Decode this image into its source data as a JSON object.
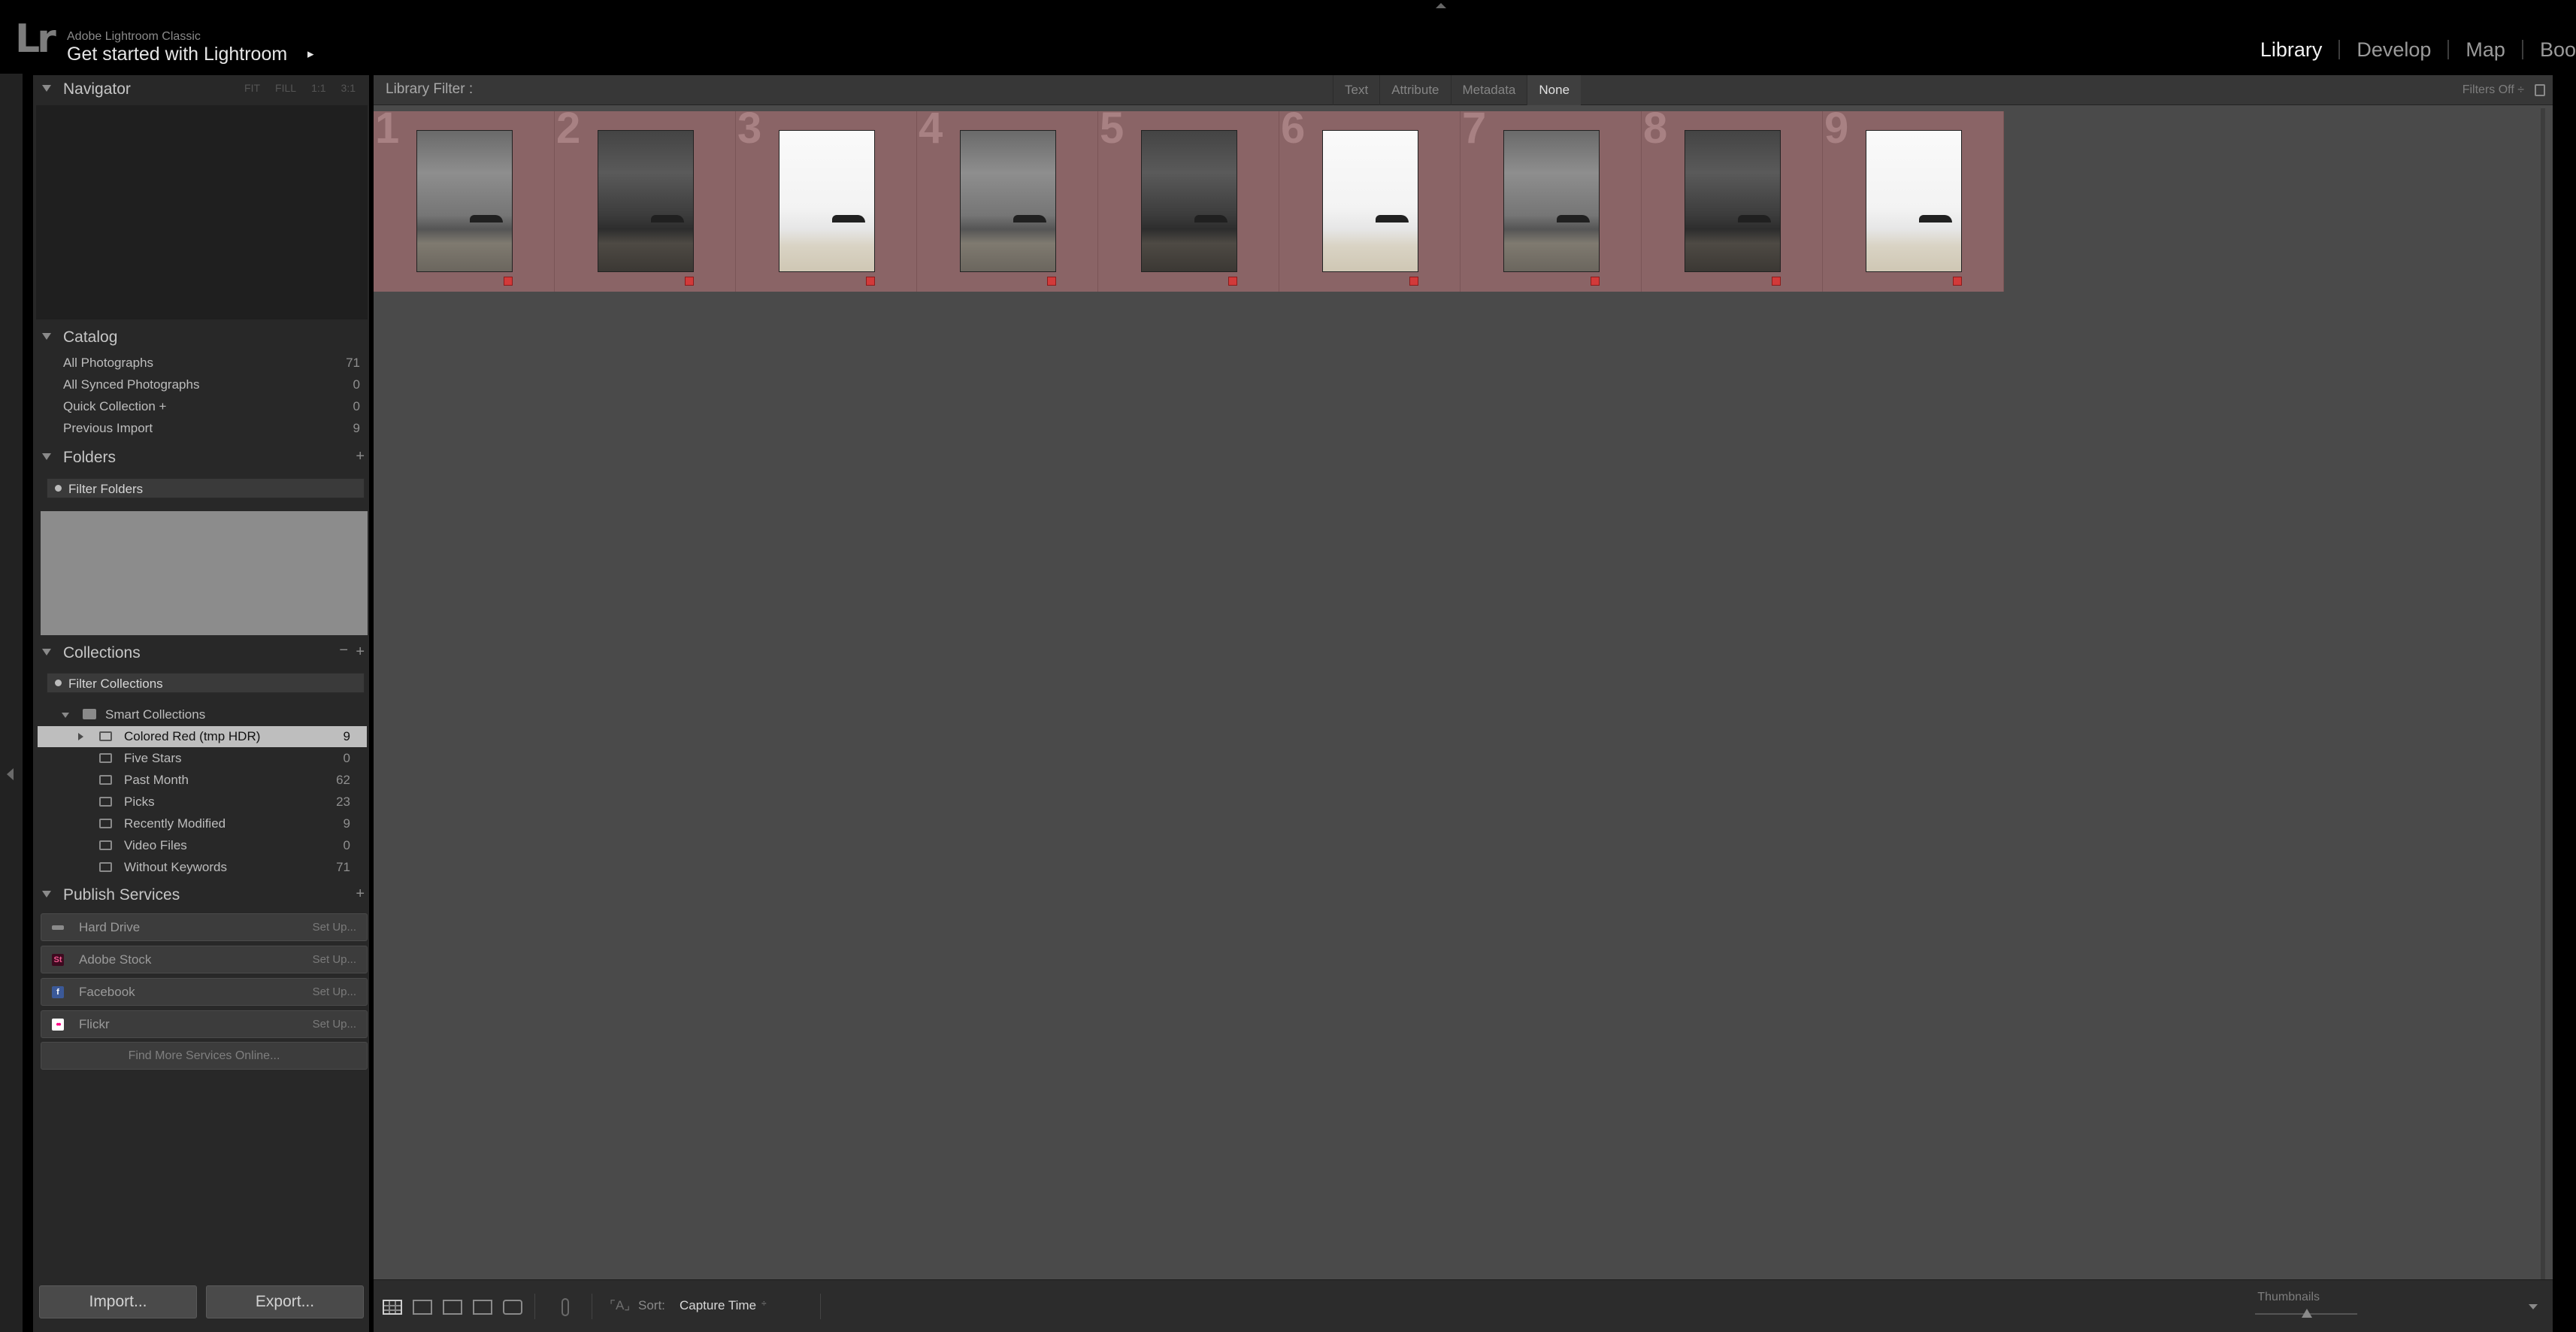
{
  "header": {
    "logo": "Lr",
    "app_name": "Adobe Lightroom Classic",
    "identity_plate": "Get started with Lightroom",
    "identity_arrow": "▸",
    "modules": [
      {
        "label": "Library",
        "active": true
      },
      {
        "label": "Develop",
        "active": false
      },
      {
        "label": "Map",
        "active": false
      },
      {
        "label": "Boo",
        "active": false
      }
    ]
  },
  "left_panel": {
    "navigator": {
      "title": "Navigator",
      "zoom_options": [
        "FIT",
        "FILL",
        "1:1",
        "3:1"
      ]
    },
    "catalog": {
      "title": "Catalog",
      "items": [
        {
          "label": "All Photographs",
          "count": "71"
        },
        {
          "label": "All Synced Photographs",
          "count": "0"
        },
        {
          "label": "Quick Collection  +",
          "count": "0"
        },
        {
          "label": "Previous Import",
          "count": "9"
        }
      ]
    },
    "folders": {
      "title": "Folders",
      "add": "+",
      "filter_placeholder": "Filter Folders"
    },
    "collections": {
      "title": "Collections",
      "remove": "−",
      "add": "+",
      "filter_placeholder": "Filter Collections",
      "smart_folder": "Smart Collections",
      "items": [
        {
          "label": "Colored Red (tmp HDR)",
          "count": "9",
          "selected": true
        },
        {
          "label": "Five Stars",
          "count": "0"
        },
        {
          "label": "Past Month",
          "count": "62"
        },
        {
          "label": "Picks",
          "count": "23"
        },
        {
          "label": "Recently Modified",
          "count": "9"
        },
        {
          "label": "Video Files",
          "count": "0"
        },
        {
          "label": "Without Keywords",
          "count": "71"
        }
      ]
    },
    "publish": {
      "title": "Publish Services",
      "add": "+",
      "services": [
        {
          "label": "Hard Drive",
          "action": "Set Up...",
          "icon": "hard-drive-icon",
          "icon_text": "",
          "icon_color": "#8a8a8a"
        },
        {
          "label": "Adobe Stock",
          "action": "Set Up...",
          "icon": "adobe-stock-icon",
          "icon_text": "St",
          "icon_color": "#3d0a1f"
        },
        {
          "label": "Facebook",
          "action": "Set Up...",
          "icon": "facebook-icon",
          "icon_text": "f",
          "icon_color": "#3b5998"
        },
        {
          "label": "Flickr",
          "action": "Set Up...",
          "icon": "flickr-icon",
          "icon_text": "••",
          "icon_color": "#ffffff"
        }
      ],
      "find_more": "Find More Services Online..."
    },
    "import_label": "Import...",
    "export_label": "Export..."
  },
  "filter_bar": {
    "title": "Library Filter :",
    "tabs": [
      {
        "label": "Text",
        "active": false
      },
      {
        "label": "Attribute",
        "active": false
      },
      {
        "label": "Metadata",
        "active": false
      },
      {
        "label": "None",
        "active": true
      }
    ],
    "preset": "Filters Off ÷"
  },
  "grid": {
    "photos": [
      {
        "index": "1",
        "tone": "mid",
        "flag": "red"
      },
      {
        "index": "2",
        "tone": "dark",
        "flag": "red"
      },
      {
        "index": "3",
        "tone": "bright",
        "flag": "red"
      },
      {
        "index": "4",
        "tone": "mid",
        "flag": "red"
      },
      {
        "index": "5",
        "tone": "dark",
        "flag": "red"
      },
      {
        "index": "6",
        "tone": "bright",
        "flag": "red"
      },
      {
        "index": "7",
        "tone": "mid",
        "flag": "red"
      },
      {
        "index": "8",
        "tone": "dark",
        "flag": "red"
      },
      {
        "index": "9",
        "tone": "bright",
        "flag": "red"
      }
    ],
    "cell_color": "#8a6466"
  },
  "toolbar": {
    "view_icons": [
      "grid-view-icon",
      "loupe-view-icon",
      "compare-view-icon",
      "survey-view-icon",
      "people-view-icon"
    ],
    "sort_arrows": "⌜A⌟",
    "sort_label": "Sort:",
    "sort_value": "Capture Time",
    "sort_caret": "÷",
    "thumbnails_label": "Thumbnails"
  }
}
